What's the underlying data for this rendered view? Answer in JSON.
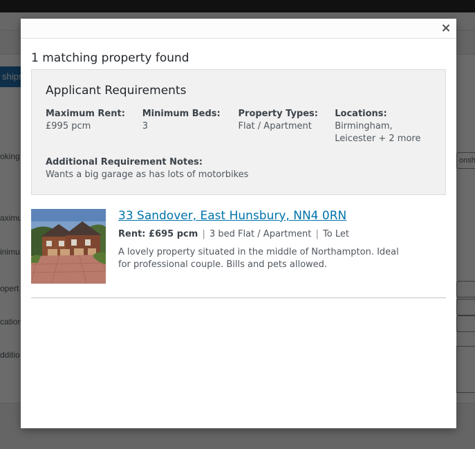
{
  "background": {
    "tab_label": "ships",
    "labels": [
      "oking",
      "aximu",
      "inimu",
      "opert",
      "cation",
      "dditio"
    ],
    "field_text": "onsh"
  },
  "modal": {
    "close_icon": "close-icon",
    "close_glyph": "×",
    "results_title": "1 matching property found"
  },
  "requirements": {
    "title": "Applicant Requirements",
    "columns": [
      {
        "label": "Maximum Rent:",
        "value": "£995 pcm"
      },
      {
        "label": "Minimum Beds:",
        "value": "3"
      },
      {
        "label": "Property Types:",
        "value": "Flat / Apartment"
      },
      {
        "label": "Locations:",
        "value_line1": "Birmingham,",
        "value_line2": "Leicester + 2 more"
      }
    ],
    "notes_label": "Additional Requirement Notes:",
    "notes_value": "Wants a big garage as has lots of motorbikes"
  },
  "property": {
    "address": "33 Sandover, East Hunsbury, NN4 0RN",
    "rent": "Rent: £695 pcm",
    "separator": "|",
    "beds_type": "3 bed Flat / Apartment",
    "status": "To Let",
    "description": "A lovely property situated in the middle of Northampton. Ideal for professional couple. Bills and pets allowed.",
    "thumbnail_icon": "property-photo"
  },
  "colors": {
    "link": "#0073aa",
    "tab_accent": "#2271b1",
    "overlay": "rgba(0,0,0,0.58)"
  }
}
